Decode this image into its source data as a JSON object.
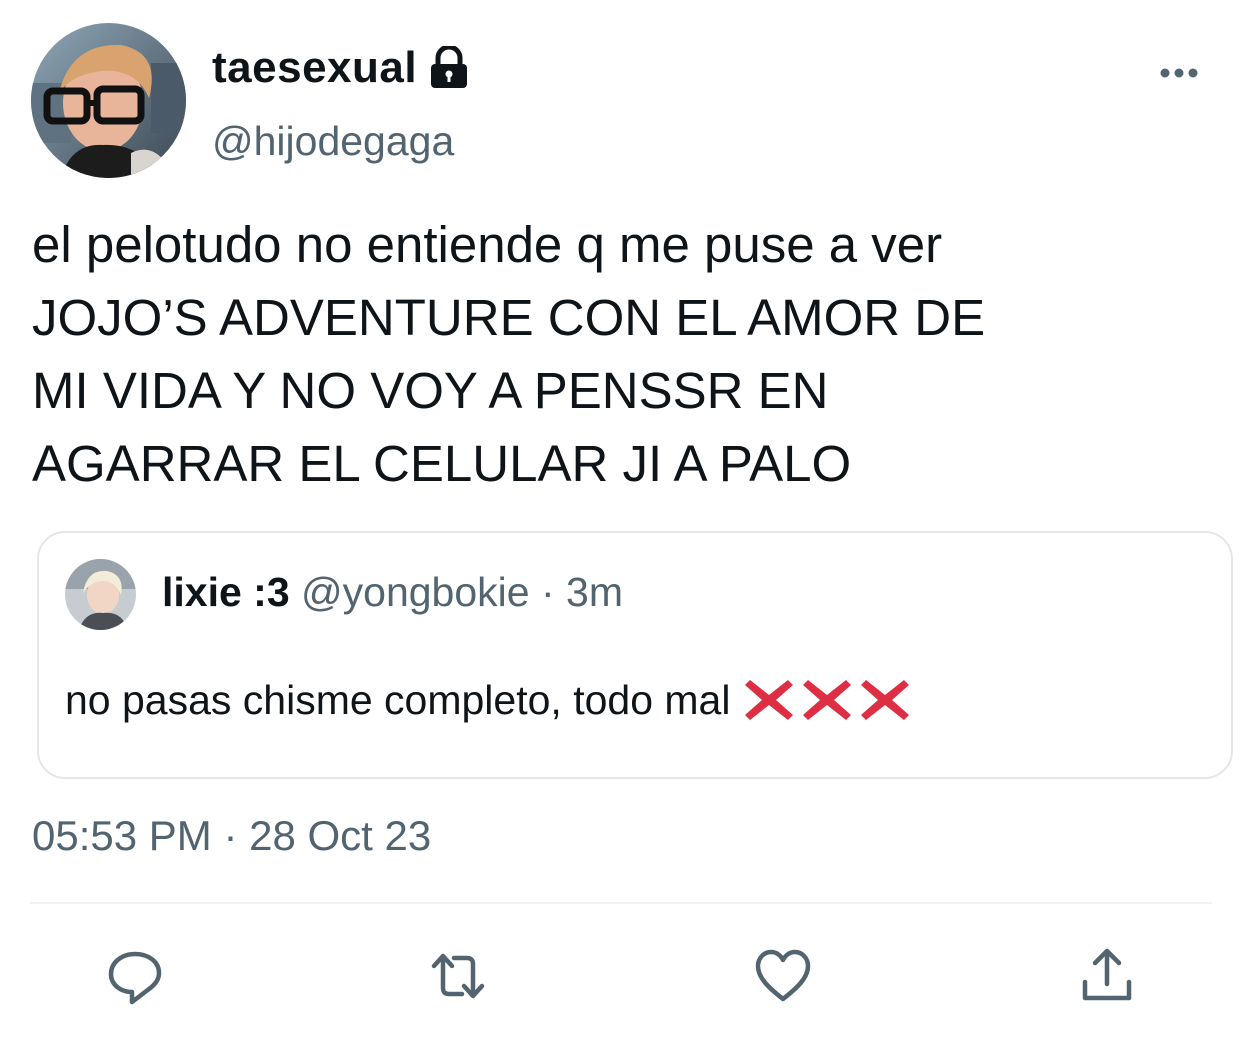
{
  "author": {
    "display_name": "taesexual",
    "handle": "@hijodegaga",
    "protected_icon": "lock-icon"
  },
  "tweet": {
    "lines": [
      "el pelotudo no entiende q me puse a ver",
      "JOJO’S ADVENTURE CON EL AMOR DE",
      "MI VIDA Y NO VOY A PENSSR EN",
      "AGARRAR EL CELULAR JI A PALO"
    ]
  },
  "quoted_tweet": {
    "display_name": "lixie :3",
    "handle": "@yongbokie",
    "separator": "·",
    "time_ago": "3m",
    "text": "no pasas chisme completo, todo mal",
    "emoji": [
      "cross-mark-icon",
      "cross-mark-icon",
      "cross-mark-icon"
    ]
  },
  "timestamp": "05:53 PM · 28 Oct 23",
  "actions": [
    "reply-icon",
    "retweet-icon",
    "like-icon",
    "share-icon"
  ],
  "colors": {
    "text_primary": "#0f1419",
    "text_secondary": "#536471",
    "border": "#e3e7ea",
    "cross_mark": "#dd2e44"
  }
}
